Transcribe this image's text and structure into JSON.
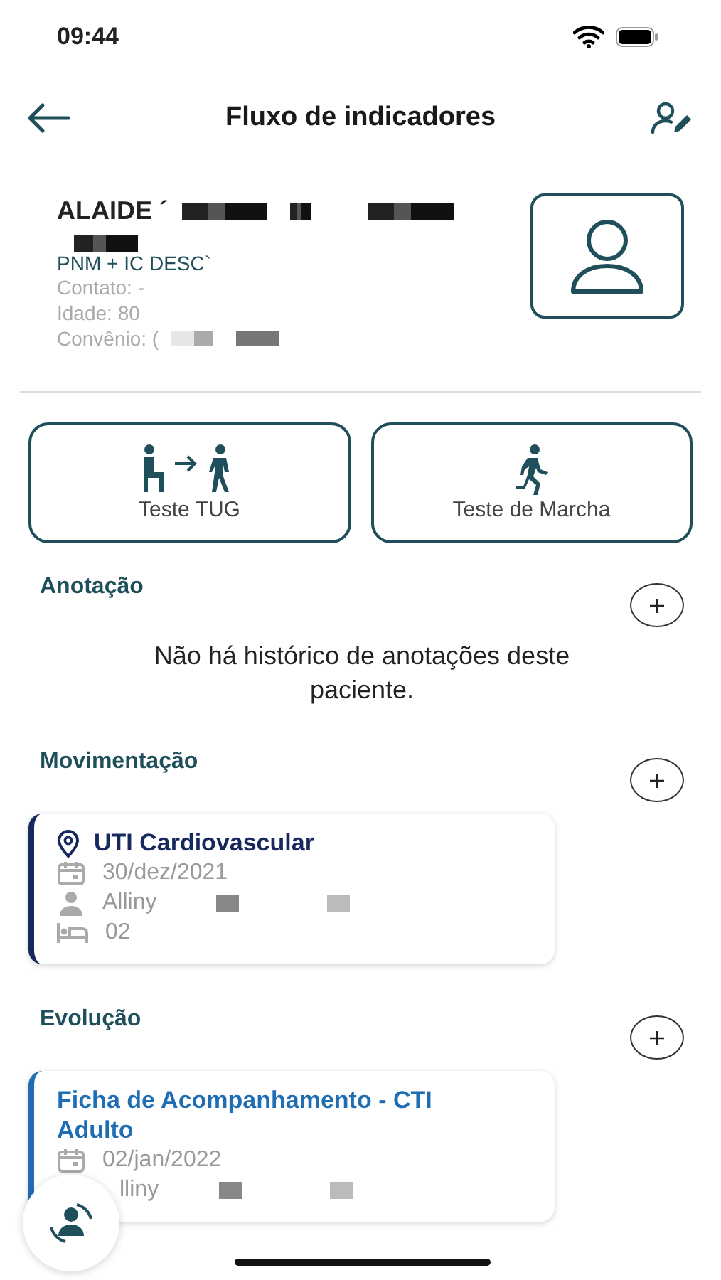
{
  "status_bar": {
    "time": "09:44"
  },
  "header": {
    "title": "Fluxo de indicadores"
  },
  "patient": {
    "name": "ALAIDE ´",
    "diagnosis": "PNM + IC DESC`",
    "details": [
      "Contato: -",
      "Idade: 80",
      "Convênio: ("
    ]
  },
  "tests": [
    {
      "label": "Teste TUG",
      "kind": "tug"
    },
    {
      "label": "Teste de Marcha",
      "kind": "gait"
    }
  ],
  "sections": [
    {
      "title": "Anotação",
      "empty_text": "Não há histórico de anotações deste paciente.",
      "kind": "empty"
    },
    {
      "title": "Movimentação",
      "cards": [
        {
          "color": "#17285e",
          "title": "UTI Cardiovascular",
          "kind": "location",
          "rows": [
            {
              "kind": "date",
              "text": "30/dez/2021"
            },
            {
              "kind": "staff",
              "text": "Alliny"
            },
            {
              "kind": "bed",
              "text": "02"
            }
          ]
        }
      ]
    },
    {
      "title": "Evolução",
      "cards": [
        {
          "color": "#1f6db3",
          "title": "Ficha de Acompanhamento - CTI Adulto",
          "kind": "plain",
          "rows": [
            {
              "kind": "date",
              "text": "02/jan/2022"
            },
            {
              "kind": "hidden",
              "text": "lliny"
            }
          ]
        }
      ]
    }
  ]
}
